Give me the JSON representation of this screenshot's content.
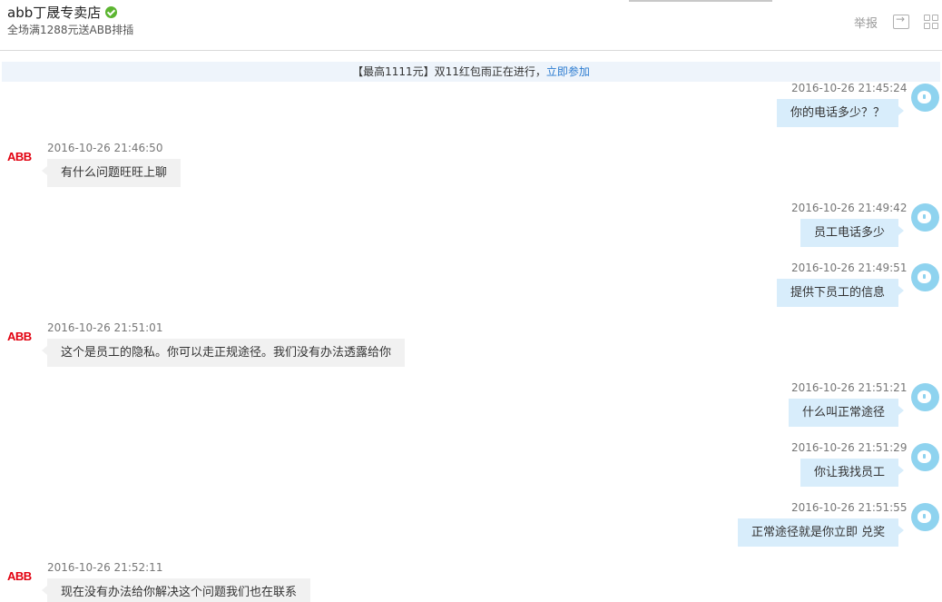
{
  "header": {
    "shop_name": "abb丁晟专卖店",
    "promo": "全场满1288元送ABB排插",
    "report_label": "举报"
  },
  "banner": {
    "text": "【最高1111元】双11红包雨正在进行，",
    "link": "立即参加"
  },
  "icons": [
    "verified-icon",
    "export-icon",
    "grid-icon",
    "abb-logo",
    "avatar"
  ],
  "colors": {
    "incoming_bubble": "#f1f1f1",
    "outgoing_bubble": "#d8edfb",
    "link": "#2b7bd0",
    "abb_red": "#e2000f",
    "verified": "#5cb531"
  },
  "messages": [
    {
      "dir": "out",
      "time": "2016-10-26 21:45:24",
      "text": "你的电话多少？？"
    },
    {
      "dir": "in",
      "sender": "ABB",
      "time": "2016-10-26 21:46:50",
      "text": "有什么问题旺旺上聊"
    },
    {
      "dir": "out",
      "time": "2016-10-26 21:49:42",
      "text": "员工电话多少"
    },
    {
      "dir": "out",
      "time": "2016-10-26 21:49:51",
      "text": "提供下员工的信息"
    },
    {
      "dir": "in",
      "sender": "ABB",
      "time": "2016-10-26 21:51:01",
      "text": "这个是员工的隐私。你可以走正规途径。我们没有办法透露给你"
    },
    {
      "dir": "out",
      "time": "2016-10-26 21:51:21",
      "text": "什么叫正常途径"
    },
    {
      "dir": "out",
      "time": "2016-10-26 21:51:29",
      "text": "你让我找员工"
    },
    {
      "dir": "out",
      "time": "2016-10-26 21:51:55",
      "text": "正常途径就是你立即 兑奖"
    },
    {
      "dir": "in",
      "sender": "ABB",
      "time": "2016-10-26 21:52:11",
      "text": "现在没有办法给你解决这个问题我们也在联系"
    }
  ]
}
